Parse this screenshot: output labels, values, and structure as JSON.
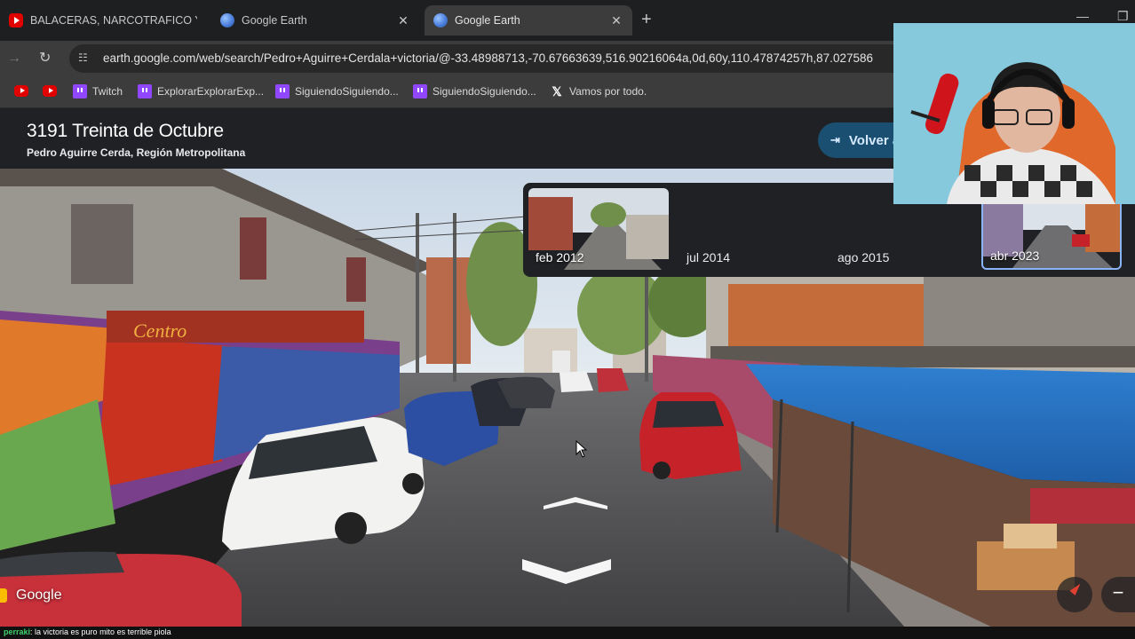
{
  "browser": {
    "tabs": [
      {
        "title": "BALACERAS, NARCOTRAFICO Y C",
        "icon": "youtube-icon",
        "active": false
      },
      {
        "title": "Google Earth",
        "icon": "google-earth-icon",
        "active": false
      },
      {
        "title": "Google Earth",
        "icon": "google-earth-icon",
        "active": true
      }
    ],
    "new_tab": "+",
    "url": "earth.google.com/web/search/Pedro+Aguirre+Cerdala+victoria/@-33.48988713,-70.67663639,516.90216064a,0d,60y,110.47874257h,87.027586",
    "bookmarks": [
      {
        "label": "",
        "icon": "youtube-icon"
      },
      {
        "label": "",
        "icon": "youtube-icon"
      },
      {
        "label": "Twitch",
        "icon": "twitch-icon"
      },
      {
        "label": "ExplorarExplorarExp...",
        "icon": "twitch-icon"
      },
      {
        "label": "SiguiendoSiguiendo...",
        "icon": "twitch-icon"
      },
      {
        "label": "SiguiendoSiguiendo...",
        "icon": "twitch-icon"
      },
      {
        "label": "Vamos por todo.",
        "icon": "x-icon"
      }
    ]
  },
  "earth": {
    "title": "3191 Treinta de Octubre",
    "subtitle": "Pedro Aguirre Cerda, Región Metropolitana",
    "back_button": "Volver a",
    "timeline": [
      {
        "label": "feb 2012",
        "has_thumb": true,
        "selected": false
      },
      {
        "label": "jul 2014",
        "has_thumb": false,
        "selected": false
      },
      {
        "label": "ago 2015",
        "has_thumb": false,
        "selected": false
      },
      {
        "label": "abr 2023",
        "has_thumb": true,
        "selected": true
      }
    ],
    "mural_text": "Centro",
    "google_logo": "Google",
    "zoom_out": "−"
  },
  "chat": {
    "user": "perraki",
    "message": ": la victoria es puro mito es terrible piola"
  },
  "colors": {
    "chrome_dark": "#1e1f20",
    "chrome_toolbar": "#3c3c3c",
    "earth_panel": "#202124",
    "back_button": "#1a4f72",
    "selected_outline": "#8ab4f8"
  }
}
